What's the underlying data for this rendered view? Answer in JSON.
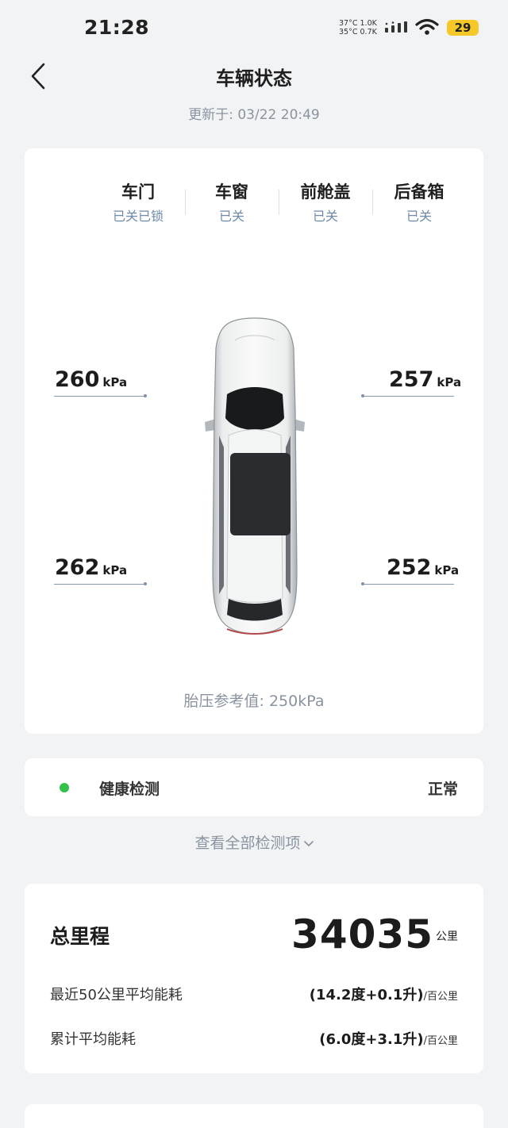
{
  "status_bar": {
    "time": "21:28",
    "temp_1": "37°C",
    "speed_1": "1.0K",
    "temp_2": "35°C",
    "speed_2": "0.7K",
    "battery": "29"
  },
  "header": {
    "title": "车辆状态",
    "updated": "更新于: 03/22 20:49"
  },
  "open_status": [
    {
      "title": "车门",
      "value": "已关已锁"
    },
    {
      "title": "车窗",
      "value": "已关"
    },
    {
      "title": "前舱盖",
      "value": "已关"
    },
    {
      "title": "后备箱",
      "value": "已关"
    }
  ],
  "tires": {
    "unit": "kPa",
    "front_left": "260",
    "front_right": "257",
    "rear_left": "262",
    "rear_right": "252",
    "reference": "胎压参考值: 250kPa"
  },
  "health": {
    "label": "健康检测",
    "status": "正常",
    "status_color": "#33c14a",
    "view_all": "查看全部检测项"
  },
  "mileage": {
    "label": "总里程",
    "value": "34035",
    "unit": "公里",
    "recent_label": "最近50公里平均能耗",
    "recent_value": "(14.2度+0.1升)",
    "recent_unit": "/百公里",
    "total_label": "累计平均能耗",
    "total_value": "(6.0度+3.1升)",
    "total_unit": "/百公里"
  }
}
